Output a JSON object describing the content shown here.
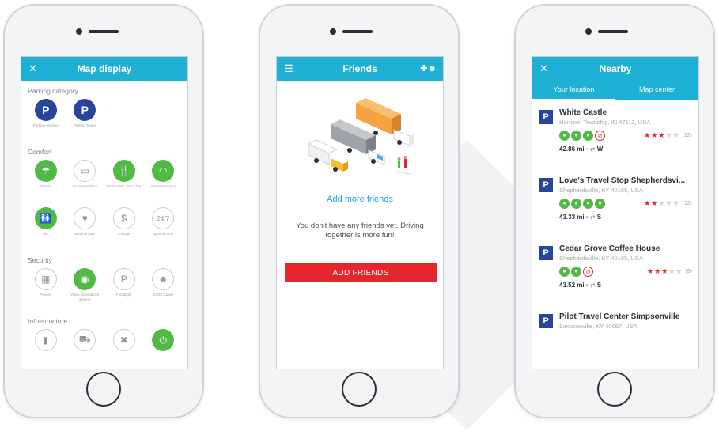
{
  "colors": {
    "accent": "#1fb0d5",
    "danger": "#e6262e",
    "green": "#52b947",
    "navy": "#27459b"
  },
  "phone1": {
    "title": "Map display",
    "left_icon": "close-icon",
    "sections": [
      {
        "name": "Parking category",
        "items": [
          {
            "icon": "parking-icon",
            "glyph": "P",
            "style": "navy",
            "label": "Parking position"
          },
          {
            "icon": "parking-icon",
            "glyph": "P",
            "style": "navy",
            "label": "Parking Space"
          }
        ]
      },
      {
        "name": "Comfort",
        "items": [
          {
            "icon": "shower-icon",
            "glyph": "☂",
            "style": "green",
            "label": "Shower"
          },
          {
            "icon": "bed-icon",
            "glyph": "▭",
            "style": "gray",
            "label": "Accommodation"
          },
          {
            "icon": "restaurant-icon",
            "glyph": "🍴",
            "style": "green",
            "label": "Restaurant, snack bar"
          },
          {
            "icon": "wifi-icon",
            "glyph": "◠",
            "style": "green",
            "label": "Internet hotspot"
          },
          {
            "icon": "wc-icon",
            "glyph": "🚻",
            "style": "green",
            "label": "WC"
          },
          {
            "icon": "medical-icon",
            "glyph": "♥",
            "style": "gray",
            "label": "Medical care"
          },
          {
            "icon": "charge-icon",
            "glyph": "$",
            "style": "gray",
            "label": "Charge"
          },
          {
            "icon": "opening-hours-icon",
            "glyph": "24/7",
            "style": "gray",
            "label": "opening time"
          }
        ]
      },
      {
        "name": "Security",
        "items": [
          {
            "icon": "fence-icon",
            "glyph": "▦",
            "style": "gray",
            "label": "Fences"
          },
          {
            "icon": "camera-icon",
            "glyph": "◉",
            "style": "green",
            "label": "Video surveillance system"
          },
          {
            "icon": "floodlight-icon",
            "glyph": "P",
            "style": "gray",
            "label": "Floodlight"
          },
          {
            "icon": "guard-icon",
            "glyph": "☻",
            "style": "gray",
            "label": "24/24 Guard"
          }
        ]
      },
      {
        "name": "Infrastructure",
        "items": [
          {
            "icon": "fuel-icon",
            "glyph": "▮",
            "style": "gray",
            "label": ""
          },
          {
            "icon": "truck-wash-icon",
            "glyph": "⛟",
            "style": "gray",
            "label": ""
          },
          {
            "icon": "repair-icon",
            "glyph": "✖",
            "style": "gray",
            "label": ""
          },
          {
            "icon": "plug-icon",
            "glyph": "⏻",
            "style": "green",
            "label": ""
          }
        ]
      }
    ]
  },
  "phone2": {
    "title": "Friends",
    "left_icon": "menu-icon",
    "right_icon": "add-friend-icon",
    "add_more": "Add more friends",
    "message": "You don't have any friends yet. Driving together is more fun!",
    "button": "ADD FRIENDS"
  },
  "phone3": {
    "title": "Nearby",
    "left_icon": "close-icon",
    "tabs": [
      {
        "label": "Your location",
        "active": true
      },
      {
        "label": "Map center",
        "active": false
      }
    ],
    "places": [
      {
        "name": "White Castle",
        "address": "Harrison Township, IN 47112, USA",
        "amenities": [
          "g",
          "g",
          "g",
          "no"
        ],
        "rating": 2.5,
        "count": "(12)",
        "distance": "42.86 mi",
        "direction": "W"
      },
      {
        "name": "Love's Travel Stop Shepherdsvi...",
        "address": "Shepherdsville, KY 40165, USA",
        "amenities": [
          "g",
          "g",
          "g",
          "g"
        ],
        "rating": 2,
        "count": "(12)",
        "distance": "43.33 mi",
        "direction": "S"
      },
      {
        "name": "Cedar Grove Coffee House",
        "address": "Shepherdsville, KY 40165, USA",
        "amenities": [
          "g",
          "g",
          "no"
        ],
        "rating": 3,
        "count": "(9)",
        "distance": "43.52 mi",
        "direction": "S"
      },
      {
        "name": "Pilot Travel Center Simpsonville",
        "address": "Simpsonville, KY 40067, USA",
        "amenities": [],
        "rating": 0,
        "count": "",
        "distance": "",
        "direction": ""
      }
    ]
  }
}
